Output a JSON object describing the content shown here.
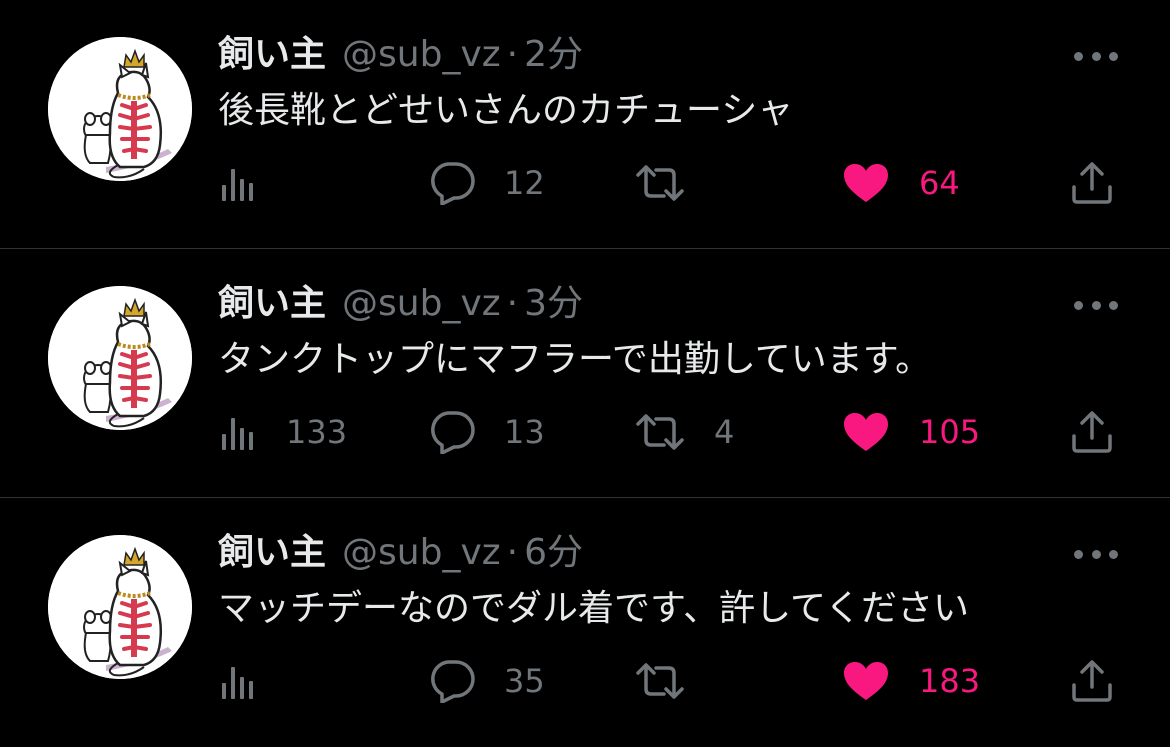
{
  "colors": {
    "background": "#000000",
    "text": "#e7e9ea",
    "muted": "#71767b",
    "like": "#f91880",
    "divider": "#2f3336"
  },
  "tweets": [
    {
      "display_name": "飼い主",
      "handle": "@sub_vz",
      "separator": "·",
      "time": "2分",
      "text": "後長靴とどせいさんのカチューシャ",
      "views": "",
      "replies": "12",
      "retweets": "",
      "likes": "64",
      "liked": true
    },
    {
      "display_name": "飼い主",
      "handle": "@sub_vz",
      "separator": "·",
      "time": "3分",
      "text": "タンクトップにマフラーで出勤しています。",
      "views": "133",
      "replies": "13",
      "retweets": "4",
      "likes": "105",
      "liked": true
    },
    {
      "display_name": "飼い主",
      "handle": "@sub_vz",
      "separator": "·",
      "time": "6分",
      "text": "マッチデーなのでダル着です、許してください",
      "views": "",
      "replies": "35",
      "retweets": "",
      "likes": "183",
      "liked": true
    }
  ],
  "icons": {
    "more": "more-dots-icon",
    "views": "analytics-icon",
    "reply": "reply-bubble-icon",
    "retweet": "retweet-icon",
    "like": "heart-icon",
    "share": "share-upload-icon"
  }
}
